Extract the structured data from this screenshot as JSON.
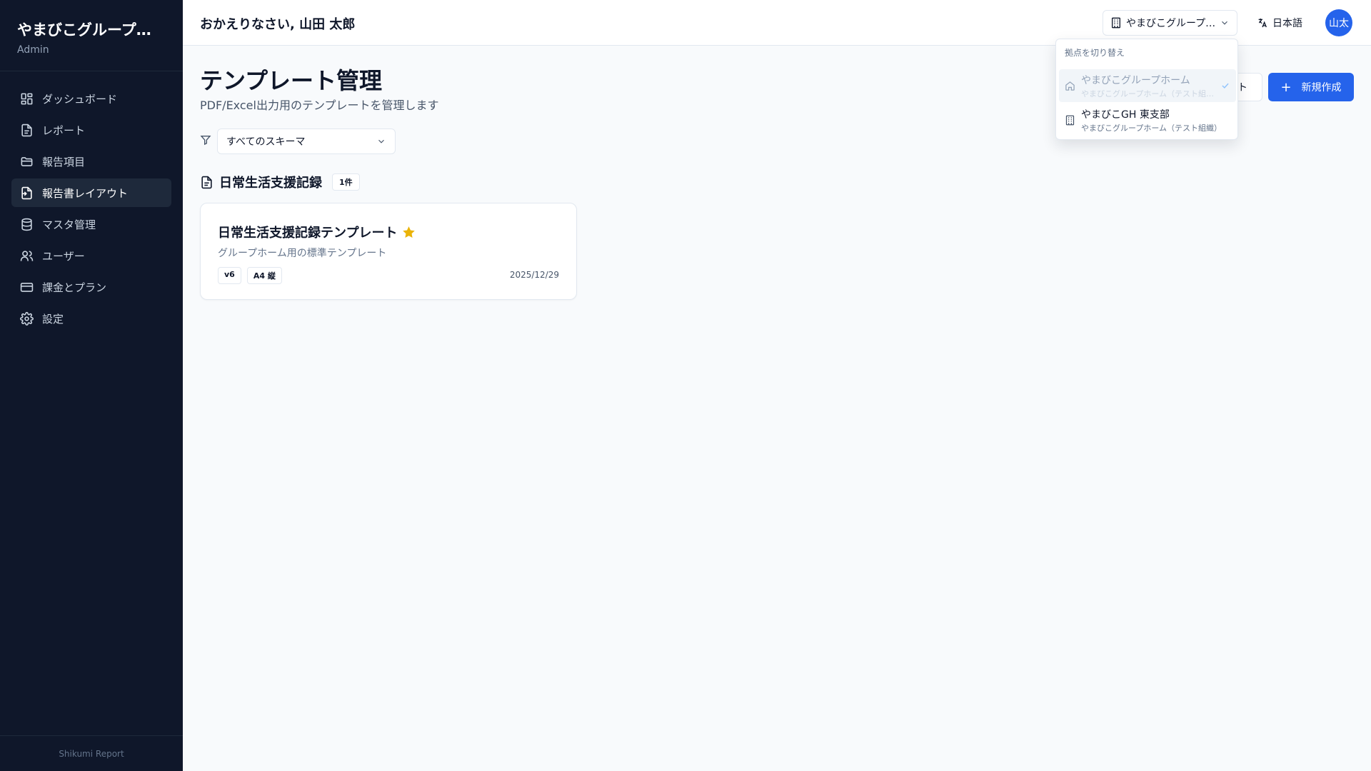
{
  "sidebar": {
    "brand_title": "やまびこグループホーム",
    "role": "Admin",
    "items": [
      {
        "label": "ダッシュボード",
        "icon": "dashboard-icon"
      },
      {
        "label": "レポート",
        "icon": "document-icon"
      },
      {
        "label": "報告項目",
        "icon": "folder-icon"
      },
      {
        "label": "報告書レイアウト",
        "icon": "file-layout-icon"
      },
      {
        "label": "マスタ管理",
        "icon": "database-icon"
      },
      {
        "label": "ユーザー",
        "icon": "users-icon"
      },
      {
        "label": "課金とプラン",
        "icon": "credit-card-icon"
      },
      {
        "label": "設定",
        "icon": "gear-icon"
      }
    ],
    "active_index": 3,
    "footer": "Shikumi Report"
  },
  "header": {
    "welcome": "おかえりなさい, 山田 太郎",
    "site_select": "やまびこグループホーム",
    "language": "日本語",
    "avatar": "山太"
  },
  "main": {
    "title": "テンプレート管理",
    "description": "PDF/Excel出力用のテンプレートを管理します",
    "secondary_button": "インポート",
    "primary_button": "新規作成",
    "filter_select": "すべてのスキーマ",
    "group": {
      "title": "日常生活支援記録",
      "count": "1件"
    },
    "card": {
      "title": "日常生活支援記録テンプレート",
      "description": "グループホーム用の標準テンプレート",
      "tags": [
        "v6",
        "A4 縦"
      ],
      "date": "2025/12/29"
    }
  },
  "dropdown": {
    "heading": "拠点を切り替え",
    "items": [
      {
        "name": "やまびこグループホーム",
        "sub": "やまびこグループホーム（テスト組織）",
        "selected": true
      },
      {
        "name": "やまびこGH 東支部",
        "sub": "やまびこグループホーム（テスト組織）",
        "selected": false
      }
    ]
  },
  "colors": {
    "sidebar_bg": "#0f172a",
    "primary": "#2563eb",
    "star": "#eab308"
  }
}
